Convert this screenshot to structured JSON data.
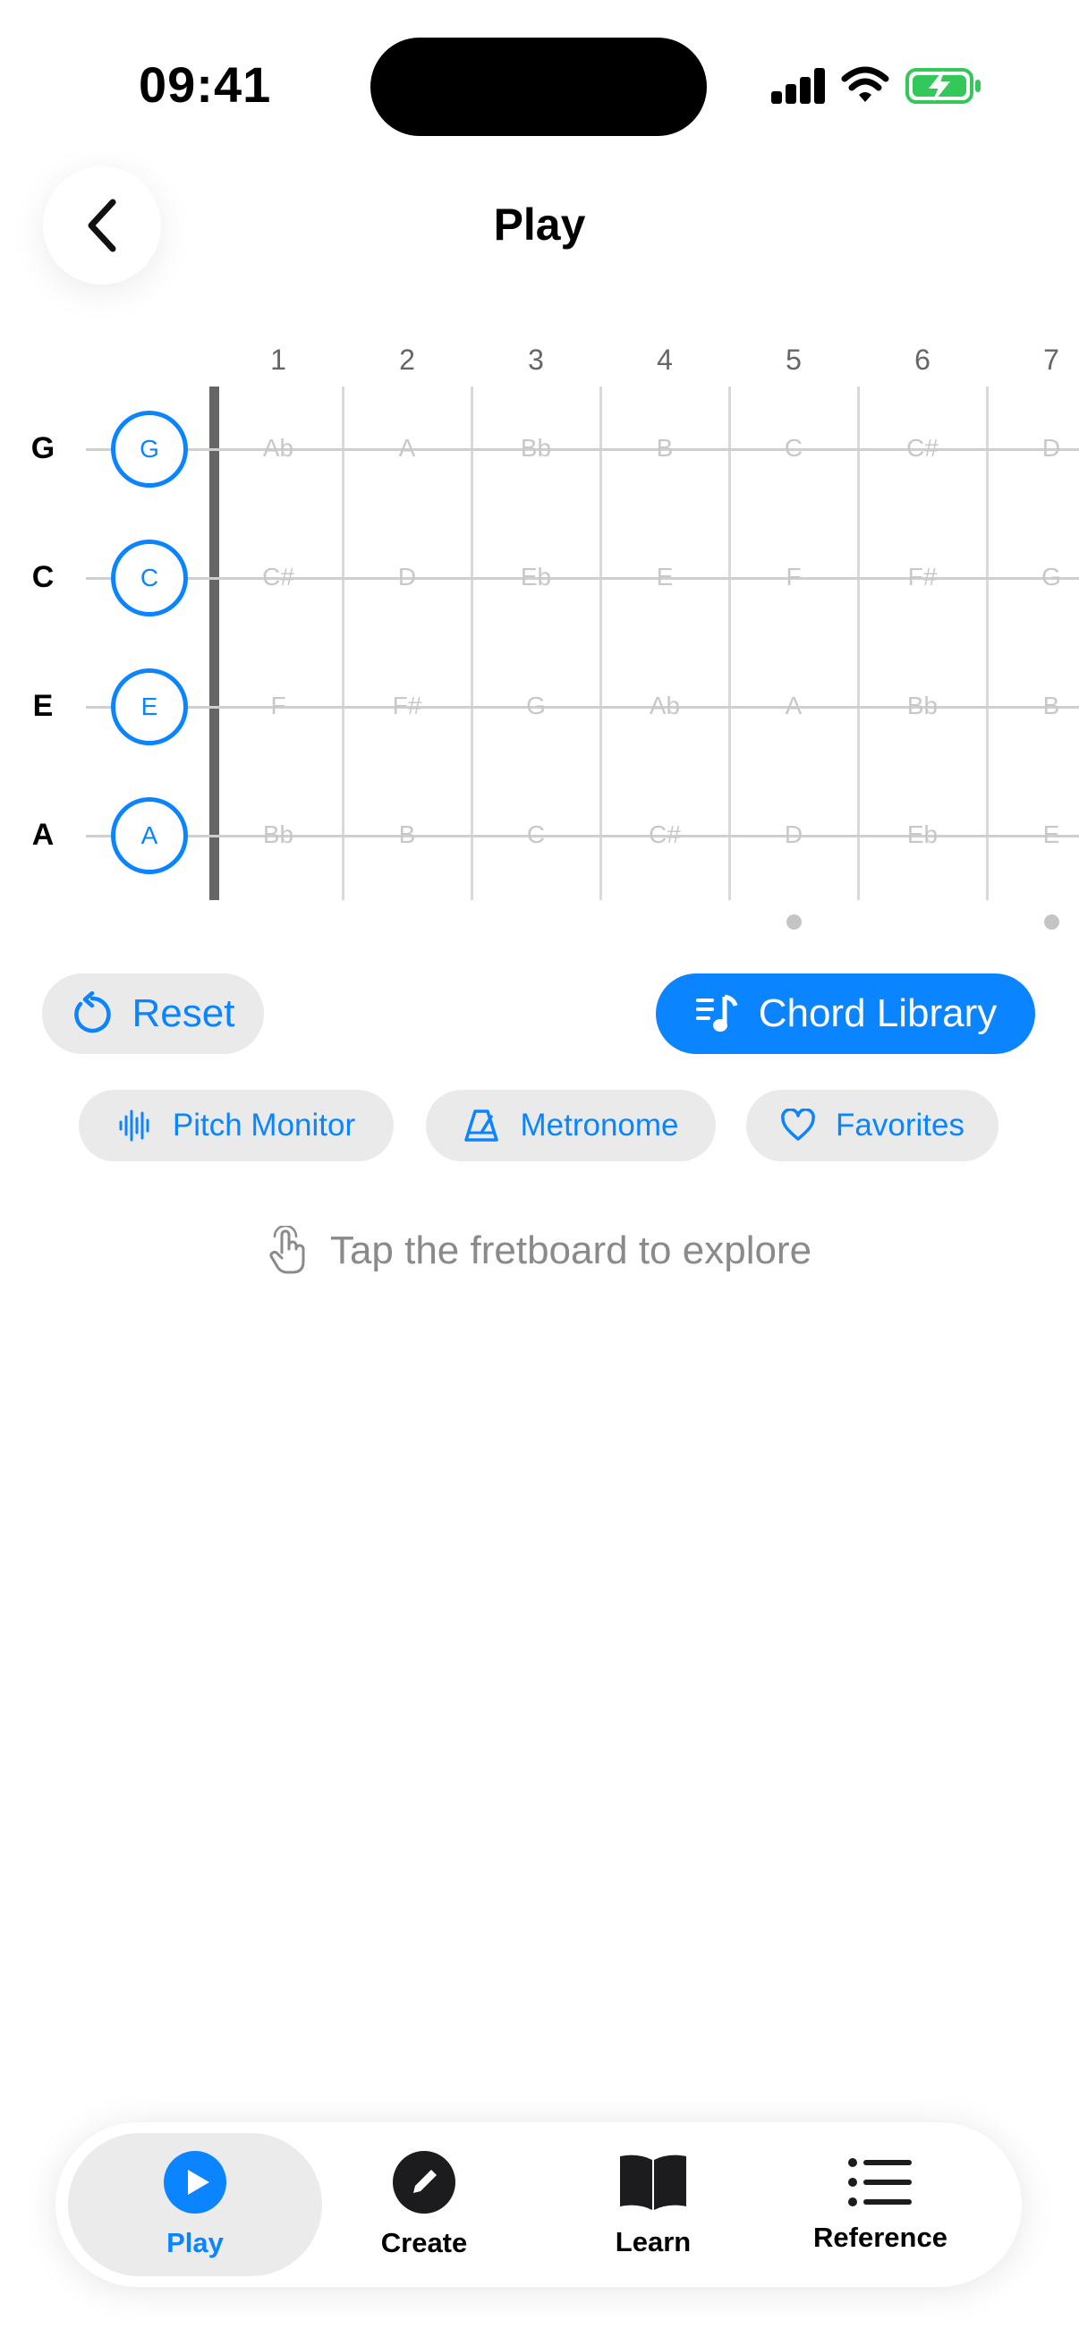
{
  "status_bar": {
    "time": "09:41"
  },
  "header": {
    "title": "Play",
    "back_icon": "chevron-left-icon"
  },
  "fretboard": {
    "fret_numbers": [
      "1",
      "2",
      "3",
      "4",
      "5",
      "6",
      "7"
    ],
    "strings": [
      {
        "name": "G",
        "open": "G",
        "notes": [
          "Ab",
          "A",
          "Bb",
          "B",
          "C",
          "C#",
          "D"
        ]
      },
      {
        "name": "C",
        "open": "C",
        "notes": [
          "C#",
          "D",
          "Eb",
          "E",
          "F",
          "F#",
          "G"
        ]
      },
      {
        "name": "E",
        "open": "E",
        "notes": [
          "F",
          "F#",
          "G",
          "Ab",
          "A",
          "Bb",
          "B"
        ]
      },
      {
        "name": "A",
        "open": "A",
        "notes": [
          "Bb",
          "B",
          "C",
          "C#",
          "D",
          "Eb",
          "E"
        ]
      }
    ],
    "fret_markers": [
      "5",
      "7"
    ],
    "accent_color": "#0a84ff"
  },
  "actions": {
    "reset_label": "Reset",
    "chord_library_label": "Chord Library",
    "pitch_monitor_label": "Pitch Monitor",
    "metronome_label": "Metronome",
    "favorites_label": "Favorites"
  },
  "hint": {
    "text": "Tap the fretboard to explore",
    "icon": "hand-tap-icon"
  },
  "tabbar": {
    "tabs": [
      {
        "label": "Play",
        "icon": "play-circle-icon",
        "active": true
      },
      {
        "label": "Create",
        "icon": "pencil-circle-icon",
        "active": false
      },
      {
        "label": "Learn",
        "icon": "book-icon",
        "active": false
      },
      {
        "label": "Reference",
        "icon": "list-icon",
        "active": false
      }
    ]
  }
}
